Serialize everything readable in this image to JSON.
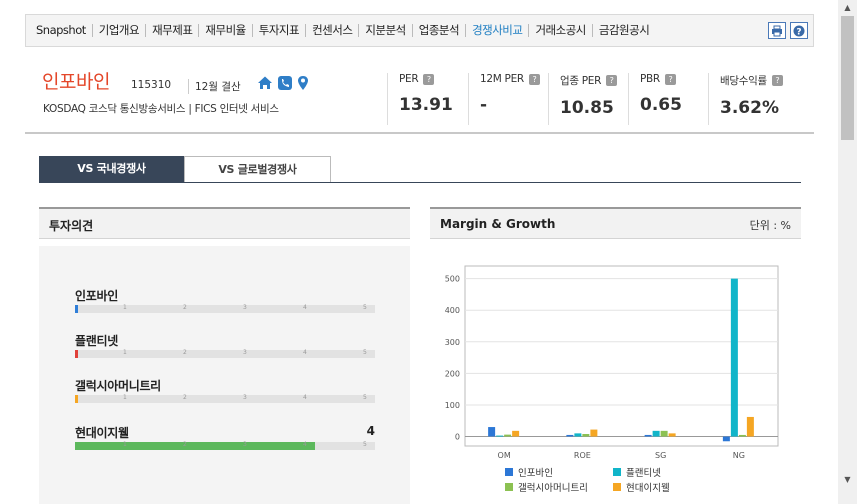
{
  "nav": {
    "items": [
      "Snapshot",
      "기업개요",
      "재무제표",
      "재무비율",
      "투자지표",
      "컨센서스",
      "지분분석",
      "업종분석",
      "경쟁사비교",
      "거래소공시",
      "금감원공시"
    ],
    "active_index": 8,
    "print_icon": "printer-icon",
    "help_icon": "help-icon"
  },
  "company": {
    "name": "인포바인",
    "code": "115310",
    "settlement": "12월 결산",
    "classification": "KOSDAQ  코스닥 통신방송서비스  |  FICS 인터넷 서비스",
    "icons": [
      "home-icon",
      "phone-icon",
      "location-icon"
    ]
  },
  "metrics": [
    {
      "label": "PER",
      "value": "13.91"
    },
    {
      "label": "12M PER",
      "value": "-"
    },
    {
      "label": "업종 PER",
      "value": "10.85"
    },
    {
      "label": "PBR",
      "value": "0.65"
    },
    {
      "label": "배당수익률",
      "value": "3.62%"
    }
  ],
  "tabs": {
    "domestic": "VS 국내경쟁사",
    "global": "VS 글로벌경쟁사"
  },
  "opinion_panel": {
    "title": "투자의견",
    "ticks": [
      "1",
      "2",
      "3",
      "4",
      "5"
    ],
    "items": [
      {
        "name": "인포바인",
        "score": "",
        "fraction": 0.008,
        "color": "#2f7ed8"
      },
      {
        "name": "플랜티넷",
        "score": "",
        "fraction": 0.008,
        "color": "#e0403a"
      },
      {
        "name": "갤럭시아머니트리",
        "score": "",
        "fraction": 0.008,
        "color": "#f5a623"
      },
      {
        "name": "현대이지웰",
        "score": "4",
        "fraction": 0.8,
        "color": "#5cb85c"
      }
    ]
  },
  "margin_panel": {
    "title": "Margin & Growth",
    "unit": "단위 : %"
  },
  "chart_data": {
    "type": "bar",
    "categories": [
      "OM",
      "ROE",
      "SG",
      "NG"
    ],
    "series": [
      {
        "name": "인포바인",
        "color": "#2c77d6",
        "values": [
          30,
          5,
          5,
          -15
        ]
      },
      {
        "name": "플랜티넷",
        "color": "#11b5c9",
        "values": [
          3,
          10,
          18,
          500
        ]
      },
      {
        "name": "갤럭시아머니트리",
        "color": "#8cc152",
        "values": [
          6,
          8,
          18,
          5
        ]
      },
      {
        "name": "현대이지웰",
        "color": "#f5a623",
        "values": [
          18,
          22,
          10,
          62
        ]
      }
    ],
    "yticks": [
      0,
      100,
      200,
      300,
      400,
      500
    ],
    "ylim": [
      -30,
      540
    ],
    "grid": true,
    "legend_position": "bottom"
  }
}
